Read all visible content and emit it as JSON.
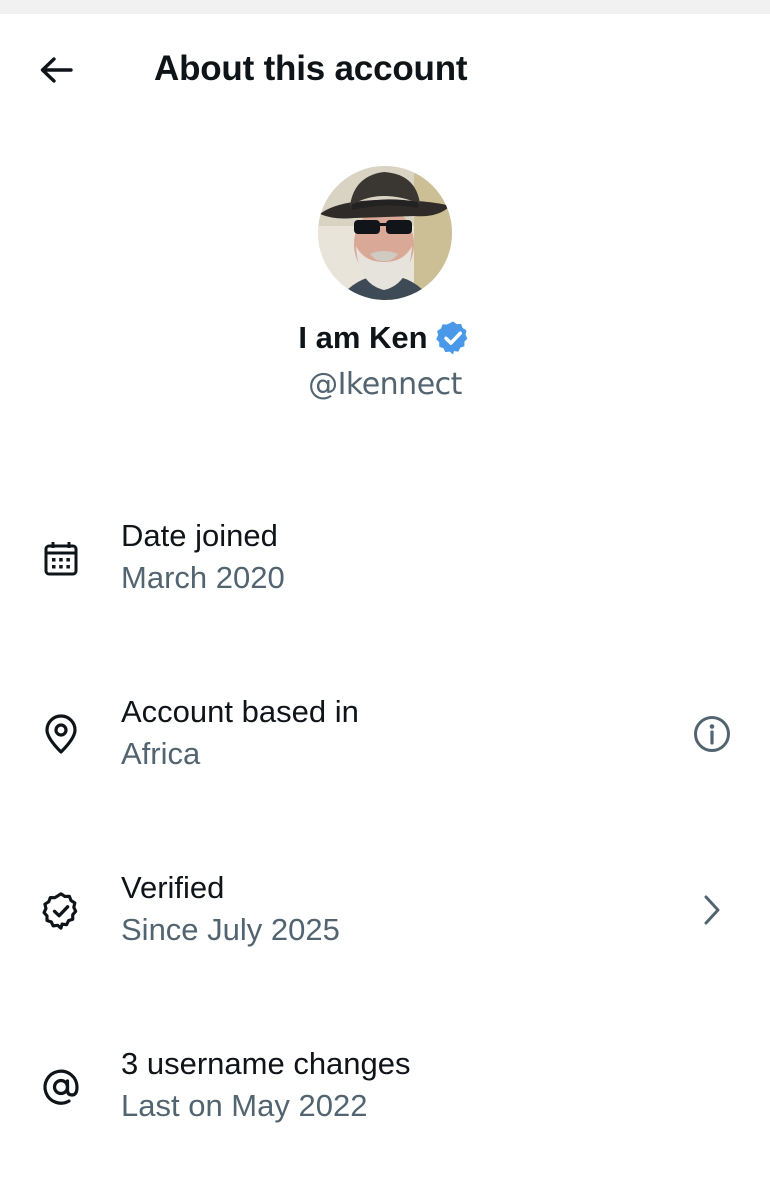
{
  "header": {
    "title": "About this account",
    "back_icon": "arrow-left-icon"
  },
  "profile": {
    "display_name": "I am Ken",
    "handle": "@Ikennect",
    "verified": true,
    "badge_color": "#4a99e9"
  },
  "details": [
    {
      "label": "Date joined",
      "value": "March 2020",
      "icon": "calendar-icon",
      "action": null
    },
    {
      "label": "Account based in",
      "value": "Africa",
      "icon": "location-pin-icon",
      "action": "info-icon"
    },
    {
      "label": "Verified",
      "value": "Since July 2025",
      "icon": "verified-check-icon",
      "action": "chevron-right-icon"
    },
    {
      "label": "3 username changes",
      "value": "Last on May 2022",
      "icon": "at-sign-icon",
      "action": null
    }
  ],
  "colors": {
    "text_primary": "#0f1419",
    "text_secondary": "#536471",
    "background": "#ffffff"
  }
}
